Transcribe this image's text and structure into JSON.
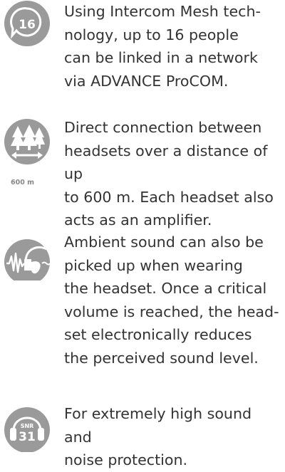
{
  "features": [
    {
      "icon": "intercom-16-icon",
      "icon_label": "16",
      "text": "Using Intercom Mesh tech-\nnology, up to 16 people\ncan be linked in a network\nvia ADVANCE ProCOM."
    },
    {
      "icon": "range-trees-icon",
      "icon_caption": "600 m",
      "text": "Direct connection between\nheadsets over a distance of up\nto 600 m. Each headset also\nacts as an amplifier."
    },
    {
      "icon": "ambient-sound-icon",
      "text": "Ambient sound can also be\npicked up when wearing\nthe headset. Once a critical\nvolume is reached, the head-\nset electronically reduces\nthe perceived sound level."
    },
    {
      "icon": "snr-31-icon",
      "icon_label_top": "SNR",
      "icon_label": "31",
      "text": "For extremely high sound and\nnoise protection."
    }
  ],
  "colors": {
    "icon_fill": "#9a9a9a",
    "text": "#333333"
  }
}
